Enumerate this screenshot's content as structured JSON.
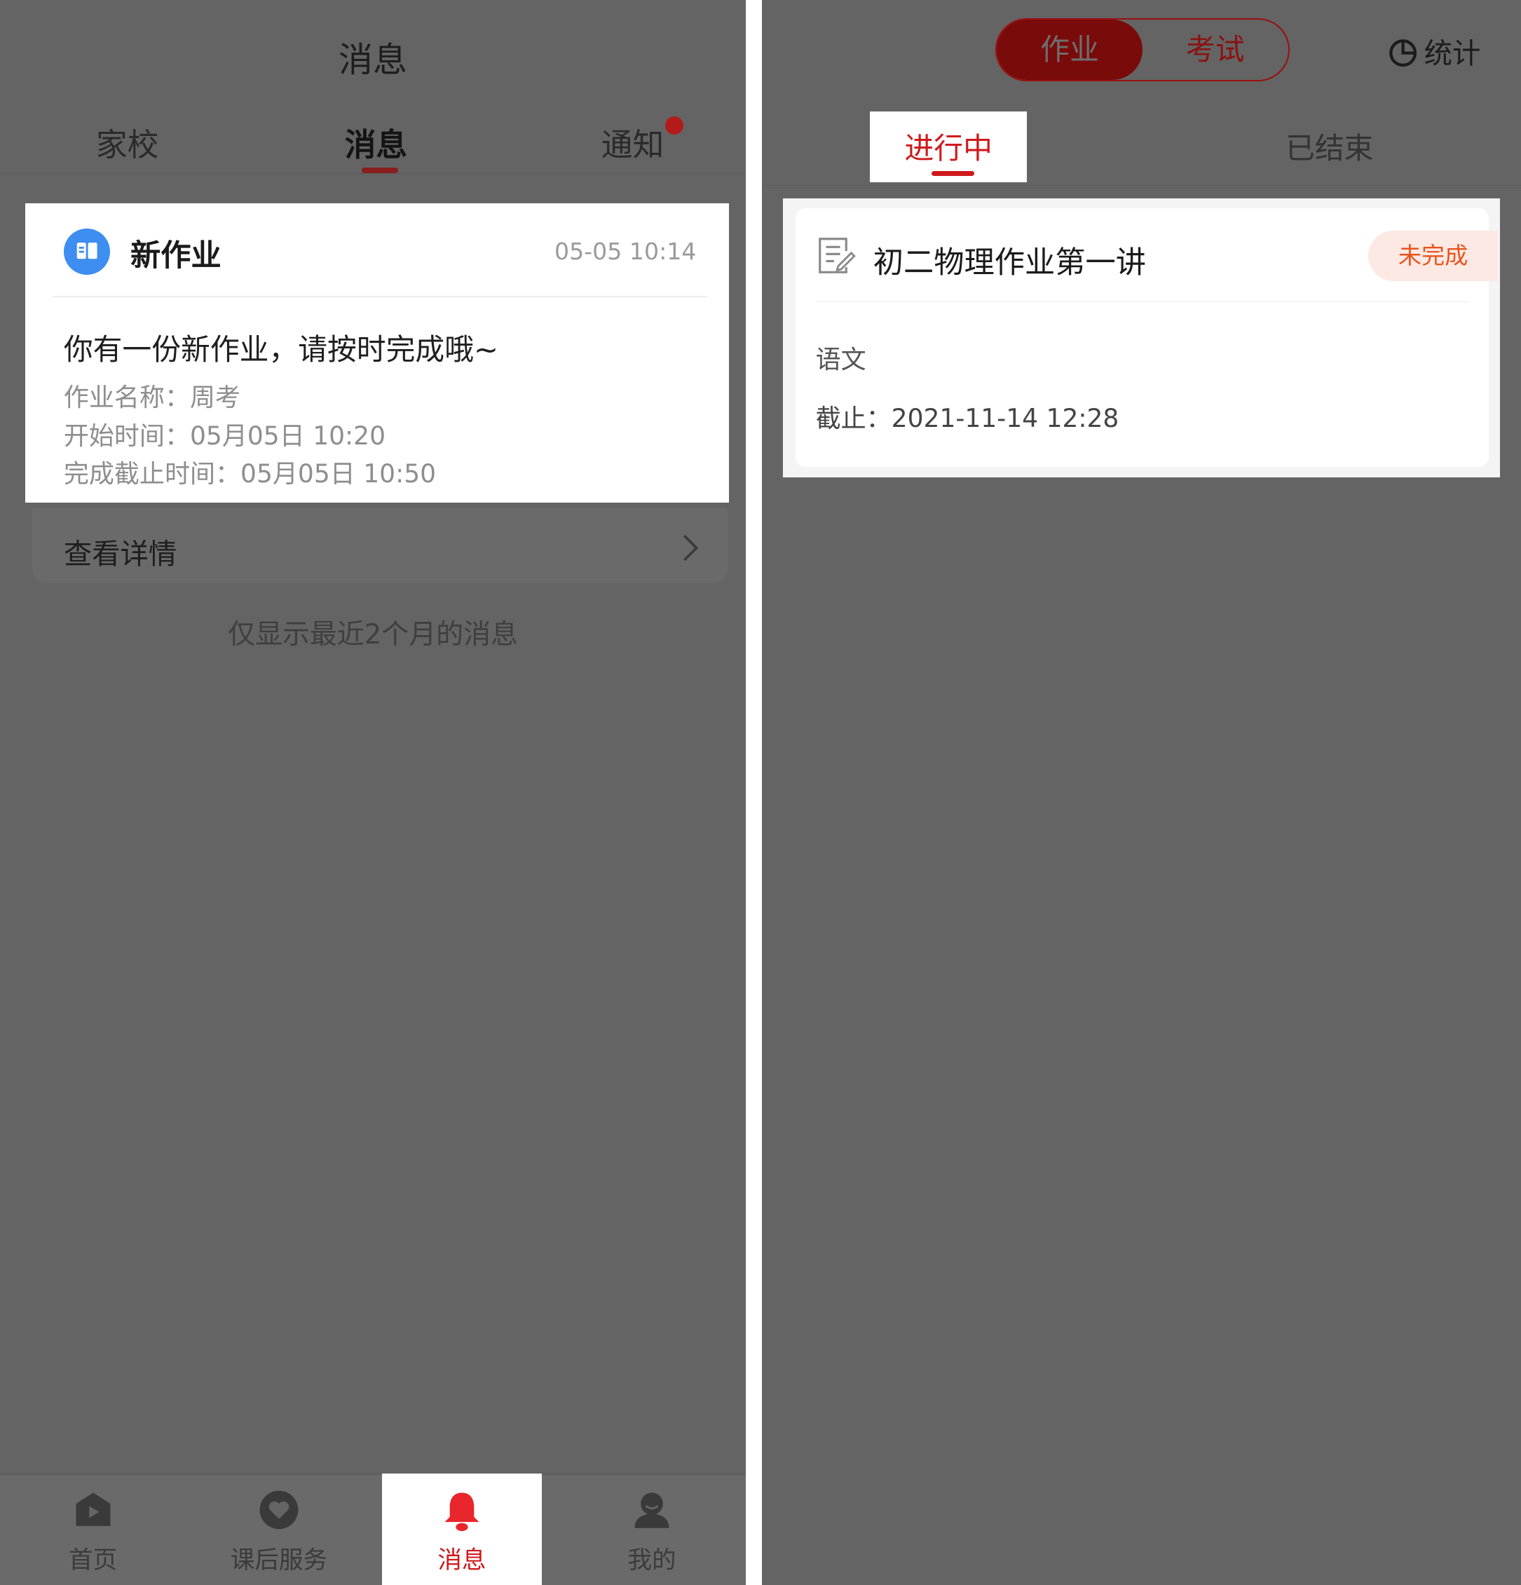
{
  "left": {
    "title": "消息",
    "tabs": [
      {
        "label": "家校"
      },
      {
        "label": "消息"
      },
      {
        "label": "通知"
      }
    ],
    "message": {
      "title": "新作业",
      "time": "05-05 10:14",
      "body": "你有一份新作业，请按时完成哦~",
      "lines": [
        "作业名称：周考",
        "开始时间：05月05日 10:20",
        "完成截止时间：05月05日 10:50"
      ]
    },
    "detail_label": "查看详情",
    "notice": "仅显示最近2个月的消息",
    "bottom_nav": [
      {
        "label": "首页",
        "icon": "home-icon"
      },
      {
        "label": "课后服务",
        "icon": "heart-icon"
      },
      {
        "label": "消息",
        "icon": "bell-icon"
      },
      {
        "label": "我的",
        "icon": "user-icon"
      }
    ]
  },
  "right": {
    "toggle": {
      "homework": "作业",
      "exam": "考试"
    },
    "stats_label": "统计",
    "tabs": {
      "running": "进行中",
      "ended": "已结束"
    },
    "card": {
      "title": "初二物理作业第一讲",
      "status": "未完成",
      "subject": "语文",
      "deadline": "截止：2021-11-14  12:28"
    }
  },
  "colors": {
    "accent_red": "#d0191c",
    "dark_red": "#7a0b0b",
    "status_orange": "#e8541e",
    "icon_blue": "#3d8ef0",
    "overlay_gray": "#646464"
  }
}
